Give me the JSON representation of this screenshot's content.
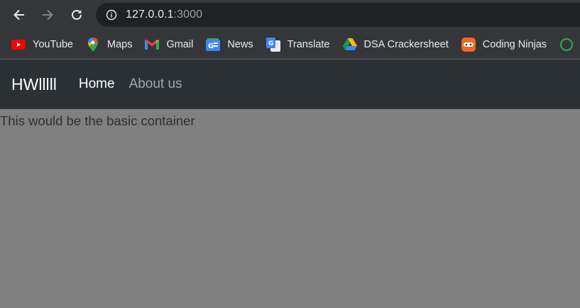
{
  "browser": {
    "url_host": "127.0.0.1",
    "url_port": ":3000",
    "bookmarks": [
      {
        "label": "YouTube",
        "icon": "youtube-icon"
      },
      {
        "label": "Maps",
        "icon": "maps-icon"
      },
      {
        "label": "Gmail",
        "icon": "gmail-icon"
      },
      {
        "label": "News",
        "icon": "news-icon"
      },
      {
        "label": "Translate",
        "icon": "translate-icon"
      },
      {
        "label": "DSA Crackersheet",
        "icon": "drive-icon"
      },
      {
        "label": "Coding Ninjas",
        "icon": "coding-ninjas-icon"
      }
    ]
  },
  "navbar": {
    "brand": "HWlllll",
    "links": [
      {
        "label": "Home"
      },
      {
        "label": "About us"
      }
    ]
  },
  "main": {
    "text": "This would be the basic container"
  },
  "colors": {
    "chrome_bg": "#35363a",
    "omnibox_bg": "#202124",
    "navbar_bg": "#2b3035",
    "page_bg": "#808080"
  }
}
